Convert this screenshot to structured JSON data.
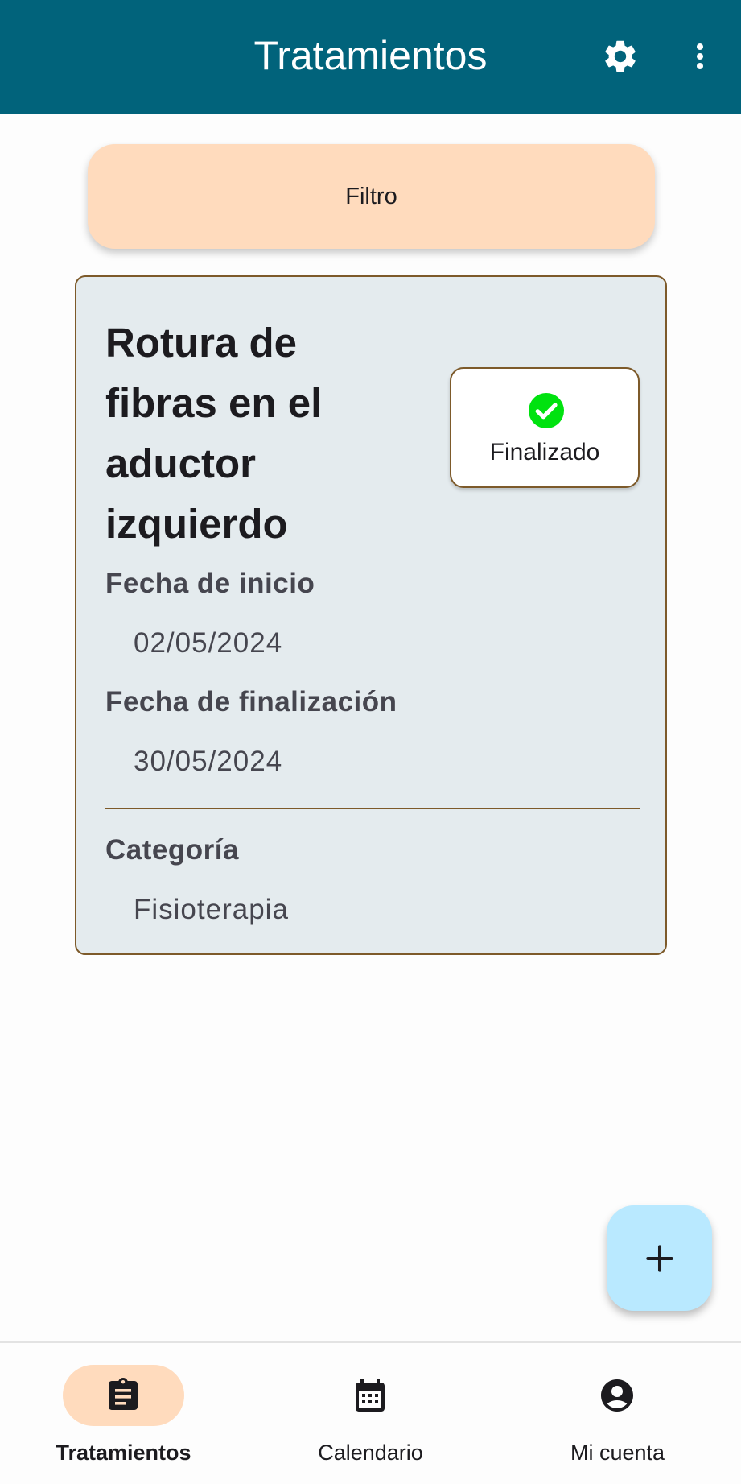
{
  "app_bar": {
    "title": "Tratamientos",
    "background": "#01637b",
    "actions": [
      "gear-icon",
      "more-vert-icon"
    ]
  },
  "filter": {
    "label": "Filtro",
    "background": "#ffdbbd"
  },
  "treatment_card": {
    "title": "Rotura de fibras en el aductor izquierdo",
    "status": {
      "label": "Finalizado",
      "icon": "check-circle-icon",
      "color": "#00e20f"
    },
    "start_date_label": "Fecha de inicio",
    "start_date": "02/05/2024",
    "end_date_label": "Fecha de finalización",
    "end_date": "30/05/2024",
    "category_label": "Categoría",
    "category": "Fisioterapia",
    "background": "#e4ebee",
    "border": "#7d5a2a"
  },
  "fab": {
    "icon": "plus-icon",
    "background": "#b9e9ff"
  },
  "bottom_nav": {
    "items": [
      {
        "label": "Tratamientos",
        "icon": "clipboard-icon",
        "active": true
      },
      {
        "label": "Calendario",
        "icon": "calendar-icon",
        "active": false
      },
      {
        "label": "Mi cuenta",
        "icon": "account-circle-icon",
        "active": false
      }
    ]
  }
}
